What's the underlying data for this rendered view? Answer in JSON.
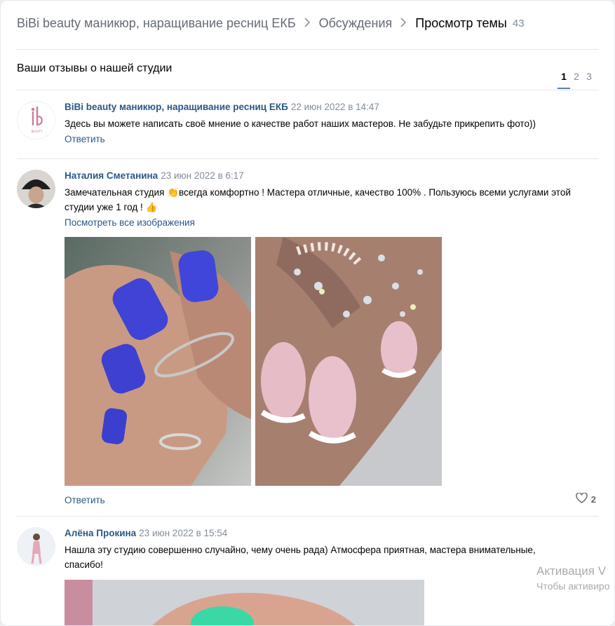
{
  "breadcrumb": {
    "group": "BiBi beauty маникюр, наращивание ресниц ЕКБ",
    "discussions": "Обсуждения",
    "current": "Просмотр темы",
    "count": "43"
  },
  "topic": {
    "title": "Ваши отзывы о нашей студии"
  },
  "pager": {
    "pages": [
      "1",
      "2",
      "3"
    ],
    "active": "1"
  },
  "posts": [
    {
      "author": "BiBi beauty маникюр, наращивание ресниц ЕКБ",
      "date": "22 июн 2022 в 14:47",
      "text": "Здесь вы можете написать своё мнение о качестве работ наших мастеров. Не забудьте прикрепить фото))",
      "reply": "Ответить",
      "avatar_logo_text": "BEAUTY"
    },
    {
      "author": "Наталия Сметанина",
      "date": "23 июн 2022 в 6:17",
      "text_part1": "Замечательная студия ",
      "text_part2": "всегда комфортно ! Мастера отличные, качество 100% . Пользуюсь всеми услугами этой студии уже 1 год ! ",
      "emoji1": "👏",
      "emoji2": "👍",
      "view_all": "Посмотреть все изображения",
      "reply": "Ответить",
      "likes": "2"
    },
    {
      "author": "Алёна Прокина",
      "date": "23 июн 2022 в 15:54",
      "text": "Нашла эту студию совершенно случайно, чему очень рада) Атмосфера приятная, мастера внимательные, спасибо!"
    }
  ],
  "watermark": {
    "title": "Активация V",
    "subtitle": "Чтобы активиро"
  },
  "colors": {
    "link": "#2a5885",
    "muted": "#818c99",
    "accent": "#5181b8",
    "divider": "#e7e8ec"
  }
}
